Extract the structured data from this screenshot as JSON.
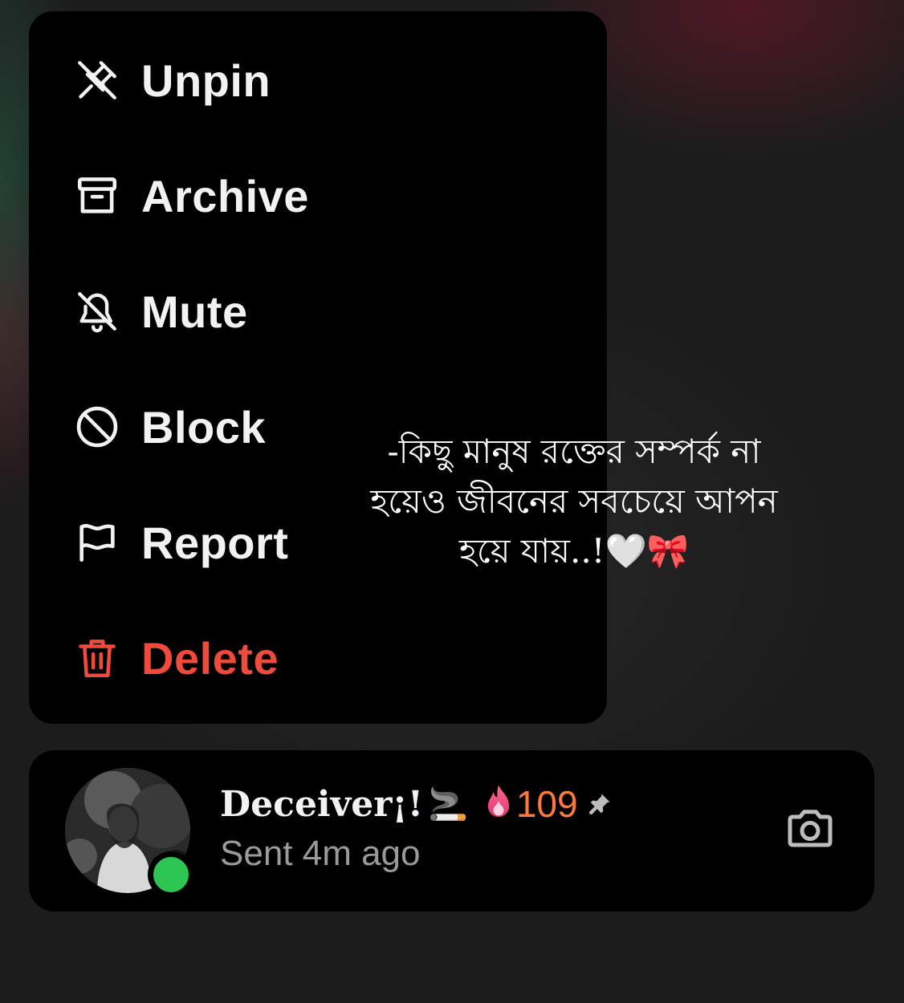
{
  "menu": {
    "items": [
      {
        "label": "Unpin",
        "icon": "unpin-icon"
      },
      {
        "label": "Archive",
        "icon": "archive-icon"
      },
      {
        "label": "Mute",
        "icon": "bell-off-icon"
      },
      {
        "label": "Block",
        "icon": "block-icon"
      },
      {
        "label": "Report",
        "icon": "flag-icon"
      },
      {
        "label": "Delete",
        "icon": "trash-icon",
        "color": "#ef4a3c"
      }
    ]
  },
  "overlay": {
    "text": "-কিছু মানুষ রক্তের সম্পর্ক না\nহয়েও জীবনের সবচেয়ে আপন\nহয়ে যায়..!🤍🎀"
  },
  "chat": {
    "name": "Deceiver¡!",
    "name_emoji": "🚬",
    "streak_emoji": "🔥",
    "streak_count": "109",
    "pinned_icon": "pin-icon",
    "status": "Sent 4m ago",
    "online": true,
    "camera_icon": "camera-icon"
  },
  "colors": {
    "danger": "#ef4a3c",
    "online": "#2dc653",
    "streak": "#ff7a3a",
    "muted_text": "#9a9a9a"
  }
}
